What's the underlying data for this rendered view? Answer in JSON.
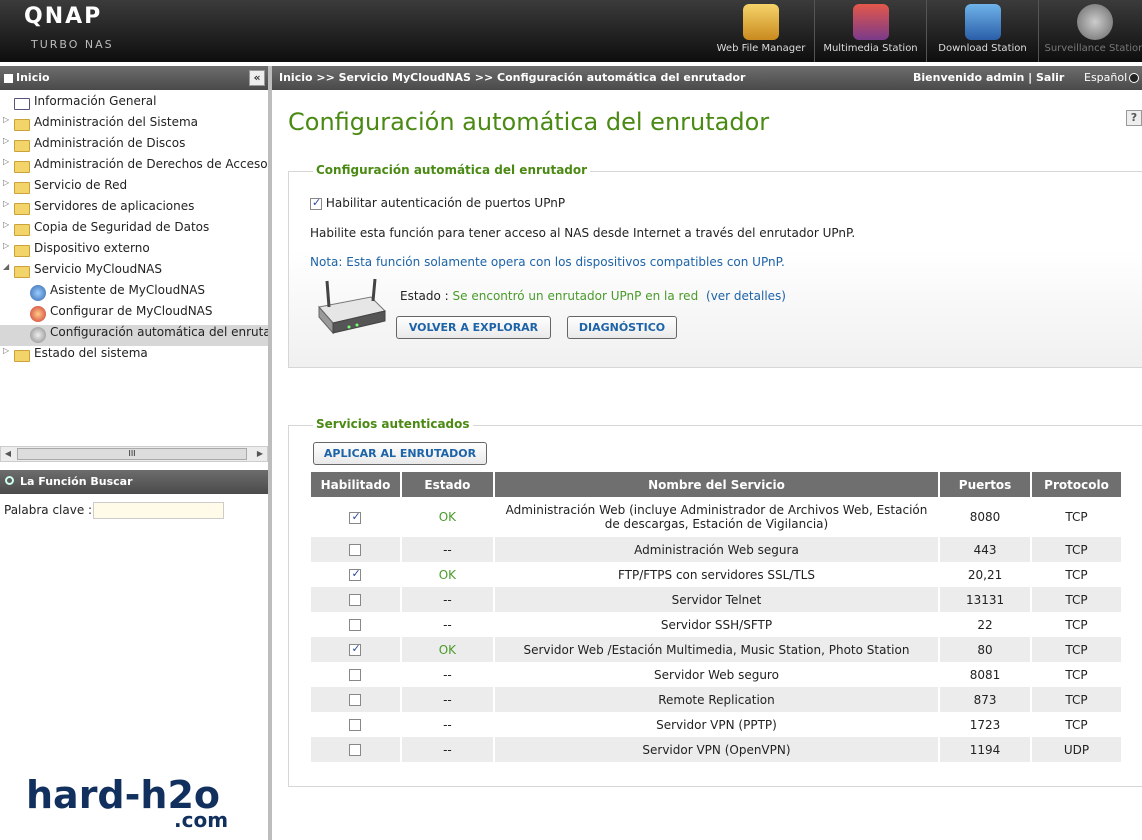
{
  "header": {
    "logo": "QNAP",
    "sublogo": "TURBO NAS",
    "apps": [
      {
        "label": "Web File Manager",
        "icon": "file-manager-icon"
      },
      {
        "label": "Multimedia Station",
        "icon": "multimedia-icon"
      },
      {
        "label": "Download Station",
        "icon": "download-icon"
      },
      {
        "label": "Surveillance Station",
        "icon": "camera-icon"
      }
    ]
  },
  "sidebar": {
    "title": "Inicio",
    "collapse": "«",
    "items": [
      "Información General",
      "Administración del Sistema",
      "Administración de Discos",
      "Administración de Derechos de Acceso",
      "Servicio de Red",
      "Servidores de aplicaciones",
      "Copia de Seguridad de Datos",
      "Dispositivo externo",
      "Servicio MyCloudNAS",
      "Asistente de MyCloudNAS",
      "Configurar de MyCloudNAS",
      "Configuración automática del enrutador",
      "Estado del sistema"
    ],
    "scroll_thumb": "III",
    "search_title": "La Función Buscar",
    "keyword_label": "Palabra clave :"
  },
  "watermark": {
    "line1": "hard-h2o",
    "line2": ".com"
  },
  "topbar": {
    "breadcrumb": "Inicio >> Servicio MyCloudNAS >> Configuración automática del enrutador",
    "welcome": "Bienvenido admin | Salir",
    "language": "Español"
  },
  "main": {
    "title": "Configuración automática del enrutador",
    "help": "?",
    "section1": {
      "legend": "Configuración automática del enrutador",
      "enable_label": "Habilitar autenticación de puertos UPnP",
      "desc": "Habilite esta función para tener acceso al NAS desde Internet a través del enrutador UPnP.",
      "note": "Nota: Esta función solamente opera con los dispositivos compatibles con UPnP.",
      "status_label": "Estado :",
      "status_value": "Se encontró un enrutador UPnP en la red",
      "details": "(ver detalles)",
      "btn_rescan": "VOLVER A EXPLORAR",
      "btn_diag": "DIAGNÓSTICO"
    },
    "section2": {
      "legend": "Servicios autenticados",
      "btn_apply": "APLICAR AL ENRUTADOR",
      "columns": [
        "Habilitado",
        "Estado",
        "Nombre del Servicio",
        "Puertos",
        "Protocolo"
      ],
      "rows": [
        {
          "enabled": true,
          "status": "OK",
          "name": "Administración Web (incluye Administrador de Archivos Web, Estación de descargas, Estación de Vigilancia)",
          "ports": "8080",
          "proto": "TCP"
        },
        {
          "enabled": false,
          "status": "--",
          "name": "Administración Web segura",
          "ports": "443",
          "proto": "TCP"
        },
        {
          "enabled": true,
          "status": "OK",
          "name": "FTP/FTPS con servidores SSL/TLS",
          "ports": "20,21",
          "proto": "TCP"
        },
        {
          "enabled": false,
          "status": "--",
          "name": "Servidor Telnet",
          "ports": "13131",
          "proto": "TCP"
        },
        {
          "enabled": false,
          "status": "--",
          "name": "Servidor SSH/SFTP",
          "ports": "22",
          "proto": "TCP"
        },
        {
          "enabled": true,
          "status": "OK",
          "name": "Servidor Web /Estación Multimedia, Music Station, Photo Station",
          "ports": "80",
          "proto": "TCP"
        },
        {
          "enabled": false,
          "status": "--",
          "name": "Servidor Web seguro",
          "ports": "8081",
          "proto": "TCP"
        },
        {
          "enabled": false,
          "status": "--",
          "name": "Remote Replication",
          "ports": "873",
          "proto": "TCP"
        },
        {
          "enabled": false,
          "status": "--",
          "name": "Servidor VPN (PPTP)",
          "ports": "1723",
          "proto": "TCP"
        },
        {
          "enabled": false,
          "status": "--",
          "name": "Servidor VPN (OpenVPN)",
          "ports": "1194",
          "proto": "UDP"
        }
      ]
    }
  }
}
